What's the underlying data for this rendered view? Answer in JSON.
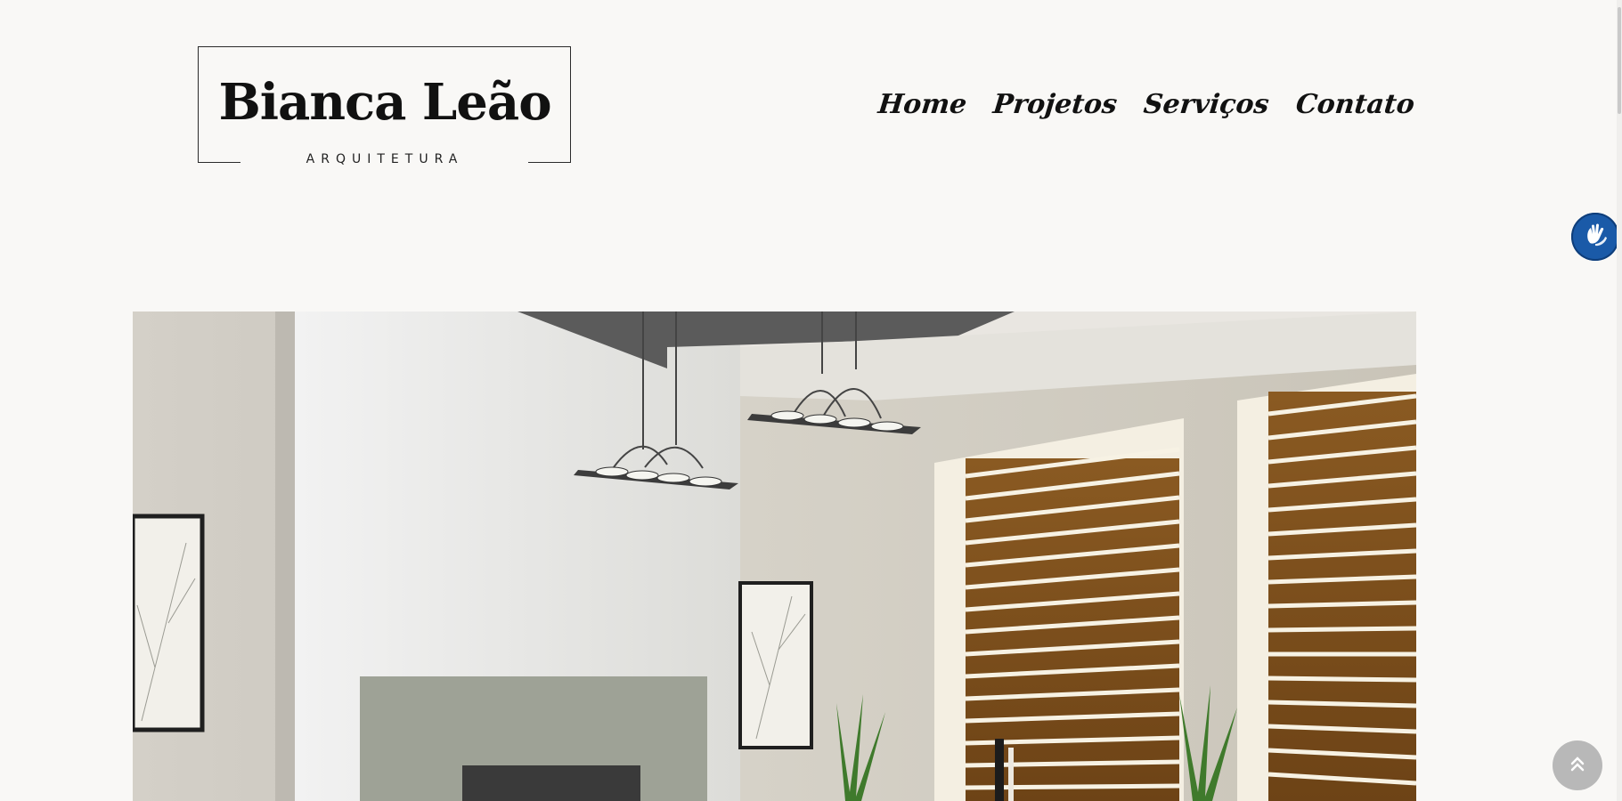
{
  "logo": {
    "name": "Bianca Leão",
    "tagline": "ARQUITETURA"
  },
  "nav": {
    "home": "Home",
    "projects": "Projetos",
    "services": "Serviços",
    "contact": "Contato"
  },
  "icons": {
    "accessibility": "sign-language-icon",
    "scroll_top": "chevron-double-up-icon"
  },
  "colors": {
    "background": "#f9f8f6",
    "accessibility_button": "#1a5aa8",
    "scroll_top_button": "#b8b8b8"
  }
}
